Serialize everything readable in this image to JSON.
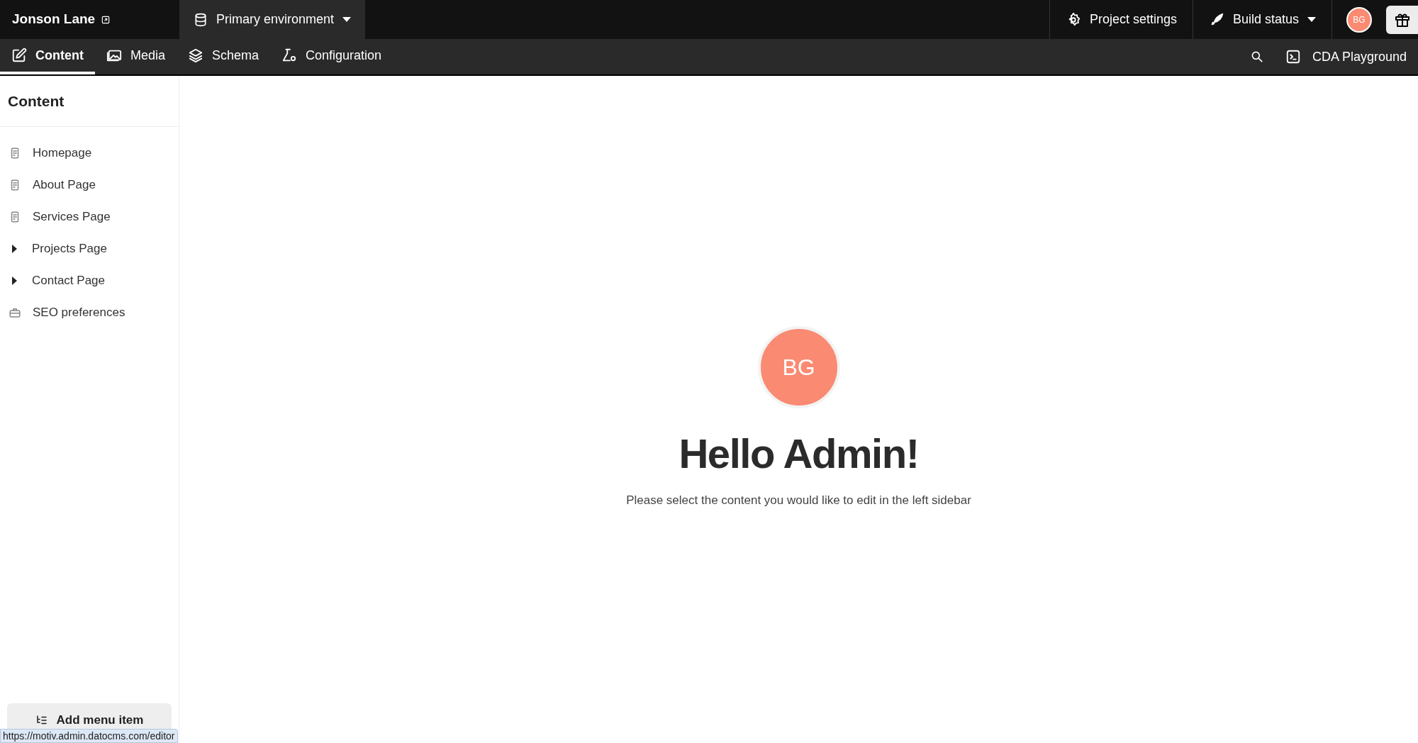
{
  "project": {
    "name": "Jonson Lane"
  },
  "environment": {
    "label": "Primary environment"
  },
  "header_actions": [
    {
      "kind": "settings",
      "label": "Project settings"
    },
    {
      "kind": "build",
      "label": "Build status"
    }
  ],
  "user": {
    "initials": "BG"
  },
  "nav_tabs": [
    {
      "kind": "content",
      "label": "Content",
      "selected": true
    },
    {
      "kind": "media",
      "label": "Media",
      "selected": false
    },
    {
      "kind": "schema",
      "label": "Schema",
      "selected": false
    },
    {
      "kind": "configuration",
      "label": "Configuration",
      "selected": false
    }
  ],
  "playground": {
    "label": "CDA Playground"
  },
  "sidebar": {
    "title": "Content",
    "items": [
      {
        "kind": "record",
        "label": "Homepage"
      },
      {
        "kind": "record",
        "label": "About Page"
      },
      {
        "kind": "record",
        "label": "Services Page"
      },
      {
        "kind": "group",
        "label": "Projects Page",
        "expanded": false
      },
      {
        "kind": "group",
        "label": "Contact Page",
        "expanded": false
      },
      {
        "kind": "settings",
        "label": "SEO preferences"
      }
    ],
    "add_button": "Add menu item"
  },
  "welcome": {
    "initials": "BG",
    "heading": "Hello Admin!",
    "message": "Please select the content you would like to edit in the left sidebar"
  },
  "status_url": "https://motiv.admin.datocms.com/editor"
}
